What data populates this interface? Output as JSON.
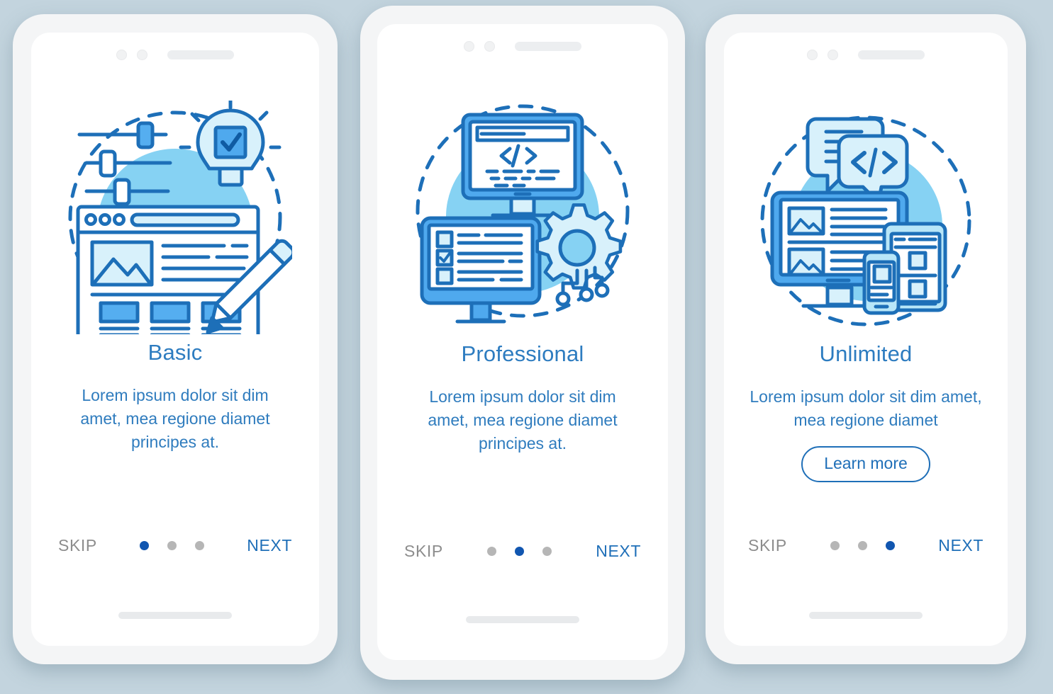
{
  "theme": {
    "page_background": "#c3d4de",
    "phone_body": "#f4f5f6",
    "screen_background": "#ffffff",
    "title_color": "#2d7cc0",
    "body_text_color": "#2f7cbe",
    "accent_blue": "#1f6fb8",
    "active_dot_color": "#1156b0",
    "inactive_dot_color": "#b6b6b6",
    "skip_color": "#8d8d8d",
    "illustration_stroke": "#1d6fb8",
    "illustration_fill_mid": "#55aef0",
    "illustration_fill_light": "#b8e6f8",
    "illustration_circle": "#86d2f3"
  },
  "screens": [
    {
      "id": "basic",
      "illustration_name": "website-builder-illustration",
      "title": "Basic",
      "description": "Lorem ipsum dolor sit dim amet, mea regione diamet principes at.",
      "has_learn_more": false,
      "learn_more_label": "",
      "skip_label": "SKIP",
      "next_label": "NEXT",
      "dots": {
        "count": 3,
        "active_index": 0
      }
    },
    {
      "id": "professional",
      "illustration_name": "code-monitor-gear-illustration",
      "title": "Professional",
      "description": "Lorem ipsum dolor sit dim amet, mea regione diamet principes at.",
      "has_learn_more": false,
      "learn_more_label": "",
      "skip_label": "SKIP",
      "next_label": "NEXT",
      "dots": {
        "count": 3,
        "active_index": 1
      }
    },
    {
      "id": "unlimited",
      "illustration_name": "responsive-devices-illustration",
      "title": "Unlimited",
      "description": "Lorem ipsum dolor sit dim amet, mea regione diamet",
      "has_learn_more": true,
      "learn_more_label": "Learn more",
      "skip_label": "SKIP",
      "next_label": "NEXT",
      "dots": {
        "count": 3,
        "active_index": 2
      }
    }
  ]
}
